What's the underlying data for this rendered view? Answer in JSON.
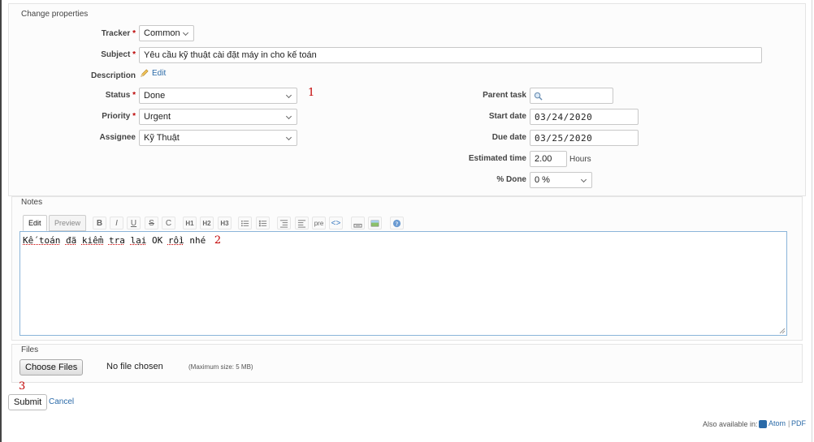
{
  "form": {
    "legend": "Change properties",
    "tracker": {
      "label": "Tracker",
      "value": "Common"
    },
    "subject": {
      "label": "Subject",
      "value": "Yêu cầu kỹ thuật cài đặt máy in cho kế toán"
    },
    "description": {
      "label": "Description",
      "edit_label": "Edit"
    },
    "status": {
      "label": "Status",
      "value": "Done"
    },
    "priority": {
      "label": "Priority",
      "value": "Urgent"
    },
    "assignee": {
      "label": "Assignee",
      "value": "Kỹ Thuật"
    },
    "parent_task": {
      "label": "Parent task",
      "value": ""
    },
    "start_date": {
      "label": "Start date",
      "value": "03/24/2020"
    },
    "due_date": {
      "label": "Due date",
      "value": "03/25/2020"
    },
    "estimated_time": {
      "label": "Estimated time",
      "value": "2.00",
      "unit": "Hours"
    },
    "done_ratio": {
      "label": "% Done",
      "value": "0 %"
    },
    "required_mark": "*"
  },
  "annotations": {
    "one": "1",
    "two": "2",
    "three": "3"
  },
  "notes": {
    "legend": "Notes",
    "tabs": {
      "edit": "Edit",
      "preview": "Preview"
    },
    "toolbar": {
      "bold": "B",
      "italic": "I",
      "underline": "U",
      "strike": "S",
      "code": "C",
      "h1": "H1",
      "h2": "H2",
      "h3": "H3",
      "pre": "pre"
    },
    "text": {
      "w1": "Kế toán",
      "w2": "đã",
      "w3": "kiểm",
      "w4": "tra",
      "w5": "lại",
      "w6": "OK",
      "w7": "rồi",
      "w8": "nhé"
    }
  },
  "files": {
    "legend": "Files",
    "choose_button": "Choose Files",
    "no_file": "No file chosen",
    "max_size": "(Maximum size: 5 MB)"
  },
  "actions": {
    "submit": "Submit",
    "cancel": "Cancel"
  },
  "footer": {
    "also_available": "Also available in:",
    "atom": "Atom",
    "separator": "|",
    "pdf": "PDF"
  }
}
